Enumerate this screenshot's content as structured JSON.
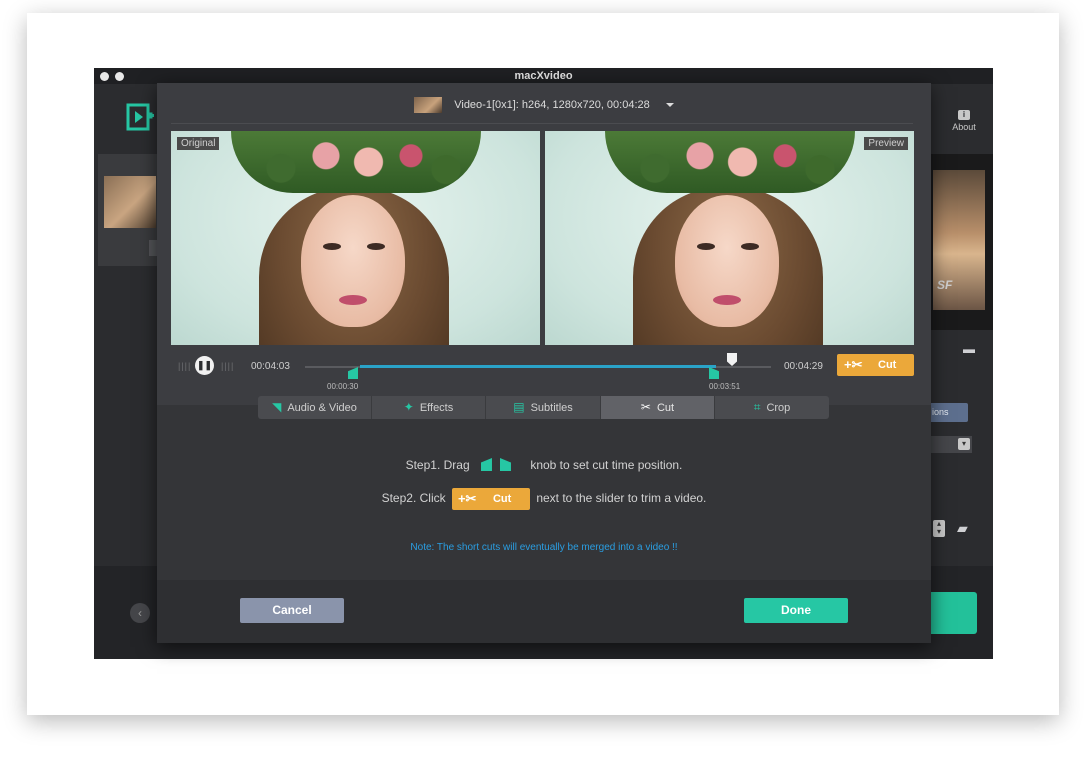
{
  "window": {
    "title": "macXvideo"
  },
  "background": {
    "about_label": "About",
    "about_icon": "info-icon",
    "options_label": "ions",
    "right_thumb_text": "SF",
    "back_icon": "chevron-left-icon",
    "accent_green": "#23c19a"
  },
  "dialog": {
    "source": {
      "label": "Video-1[0x1]: h264, 1280x720, 00:04:28",
      "dropdown_icon": "caret-down-icon"
    },
    "video": {
      "original_label": "Original",
      "preview_label": "Preview"
    },
    "player": {
      "play_pause_icon": "pause-icon",
      "current_time": "00:04:03",
      "duration": "00:04:29",
      "cut_start": "00:00:30",
      "cut_end": "00:03:51",
      "cut_button": "Cut",
      "cut_icon": "scissors-add-icon",
      "accent_blue": "#2aa3c8",
      "accent_orange": "#eba83a"
    },
    "tabs": [
      {
        "label": "Audio & Video",
        "icon": "audio-video-icon"
      },
      {
        "label": "Effects",
        "icon": "wand-icon"
      },
      {
        "label": "Subtitles",
        "icon": "subtitles-icon"
      },
      {
        "label": "Cut",
        "icon": "scissors-icon",
        "active": true
      },
      {
        "label": "Crop",
        "icon": "crop-icon"
      }
    ],
    "steps": {
      "step1_prefix": "Step1. Drag",
      "step1_suffix": "knob to set cut time position.",
      "step2_prefix": "Step2. Click",
      "step2_button": "Cut",
      "step2_suffix": "next to the slider to trim a video."
    },
    "note": "Note: The short cuts will eventually be merged into a video !!",
    "buttons": {
      "cancel": "Cancel",
      "done": "Done"
    }
  }
}
